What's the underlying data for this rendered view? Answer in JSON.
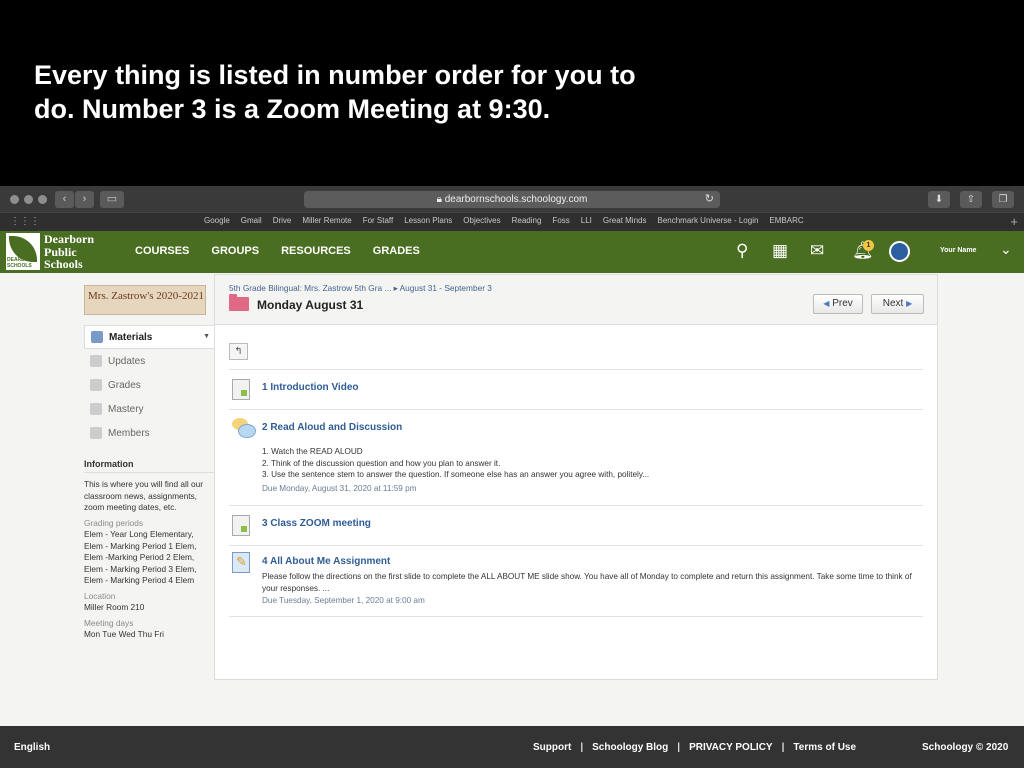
{
  "slide": {
    "caption": "Every thing is listed in number order for you to do. Number 3 is a Zoom Meeting at 9:30."
  },
  "browser": {
    "url": "dearbornschools.schoology.com",
    "bookmarks": [
      "Google",
      "Gmail",
      "Drive",
      "Miller Remote",
      "For Staff",
      "Lesson Plans",
      "Objectives",
      "Reading",
      "Foss",
      "LLI",
      "Great Minds",
      "Benchmark Universe - Login",
      "EMBARC"
    ]
  },
  "topnav": {
    "logo_lines": [
      "Dearborn",
      "Public",
      "Schools"
    ],
    "logo_small": "DEARBORN SCHOOLS",
    "items": [
      "COURSES",
      "GROUPS",
      "RESOURCES",
      "GRADES"
    ],
    "notification_count": "1",
    "user_name": "Your Name"
  },
  "sidebar": {
    "course_image_text": "Mrs. Zastrow's 2020-2021",
    "menu": [
      "Materials",
      "Updates",
      "Grades",
      "Mastery",
      "Members"
    ],
    "info_heading": "Information",
    "info_text": "This is where you will find all our classroom news, assignments, zoom meeting dates, etc.",
    "grading_label": "Grading periods",
    "grading_value": "Elem - Year Long Elementary, Elem - Marking Period 1 Elem, Elem -Marking Period 2 Elem, Elem - Marking Period 3 Elem, Elem - Marking Period 4 Elem",
    "location_label": "Location",
    "location_value": "Miller Room 210",
    "meeting_label": "Meeting days",
    "meeting_value": "Mon Tue Wed Thu Fri"
  },
  "content": {
    "breadcrumb": "5th Grade Bilingual: Mrs. Zastrow 5th Gra ... ▸ August 31 - September 3",
    "title": "Monday August 31",
    "prev_label": "Prev",
    "next_label": "Next",
    "items": [
      {
        "title": "1 Introduction Video"
      },
      {
        "title": "2 Read Aloud and Discussion",
        "lines": [
          "1. Watch the READ ALOUD",
          "2. Think of the discussion question and how you plan to answer it.",
          "3. Use the sentence stem to answer the question. If someone else has an answer you agree with, politely..."
        ],
        "due": "Due Monday, August 31, 2020 at 11:59 pm"
      },
      {
        "title": "3 Class ZOOM meeting"
      },
      {
        "title": "4 All About Me Assignment",
        "body": "Please follow the directions on the first slide to complete the ALL ABOUT ME slide show. You have all of Monday to complete and return this assignment. Take some time to think of your responses. ...",
        "due": "Due Tuesday, September 1, 2020 at 9:00 am"
      }
    ]
  },
  "footer": {
    "language": "English",
    "links": [
      "Support",
      "Schoology Blog",
      "PRIVACY POLICY",
      "Terms of Use"
    ],
    "separator": "|",
    "copyright": "Schoology © 2020"
  },
  "colors": {
    "nav_green": "#496e22",
    "link_blue": "#2f5c96",
    "footer_bg": "#333333"
  }
}
